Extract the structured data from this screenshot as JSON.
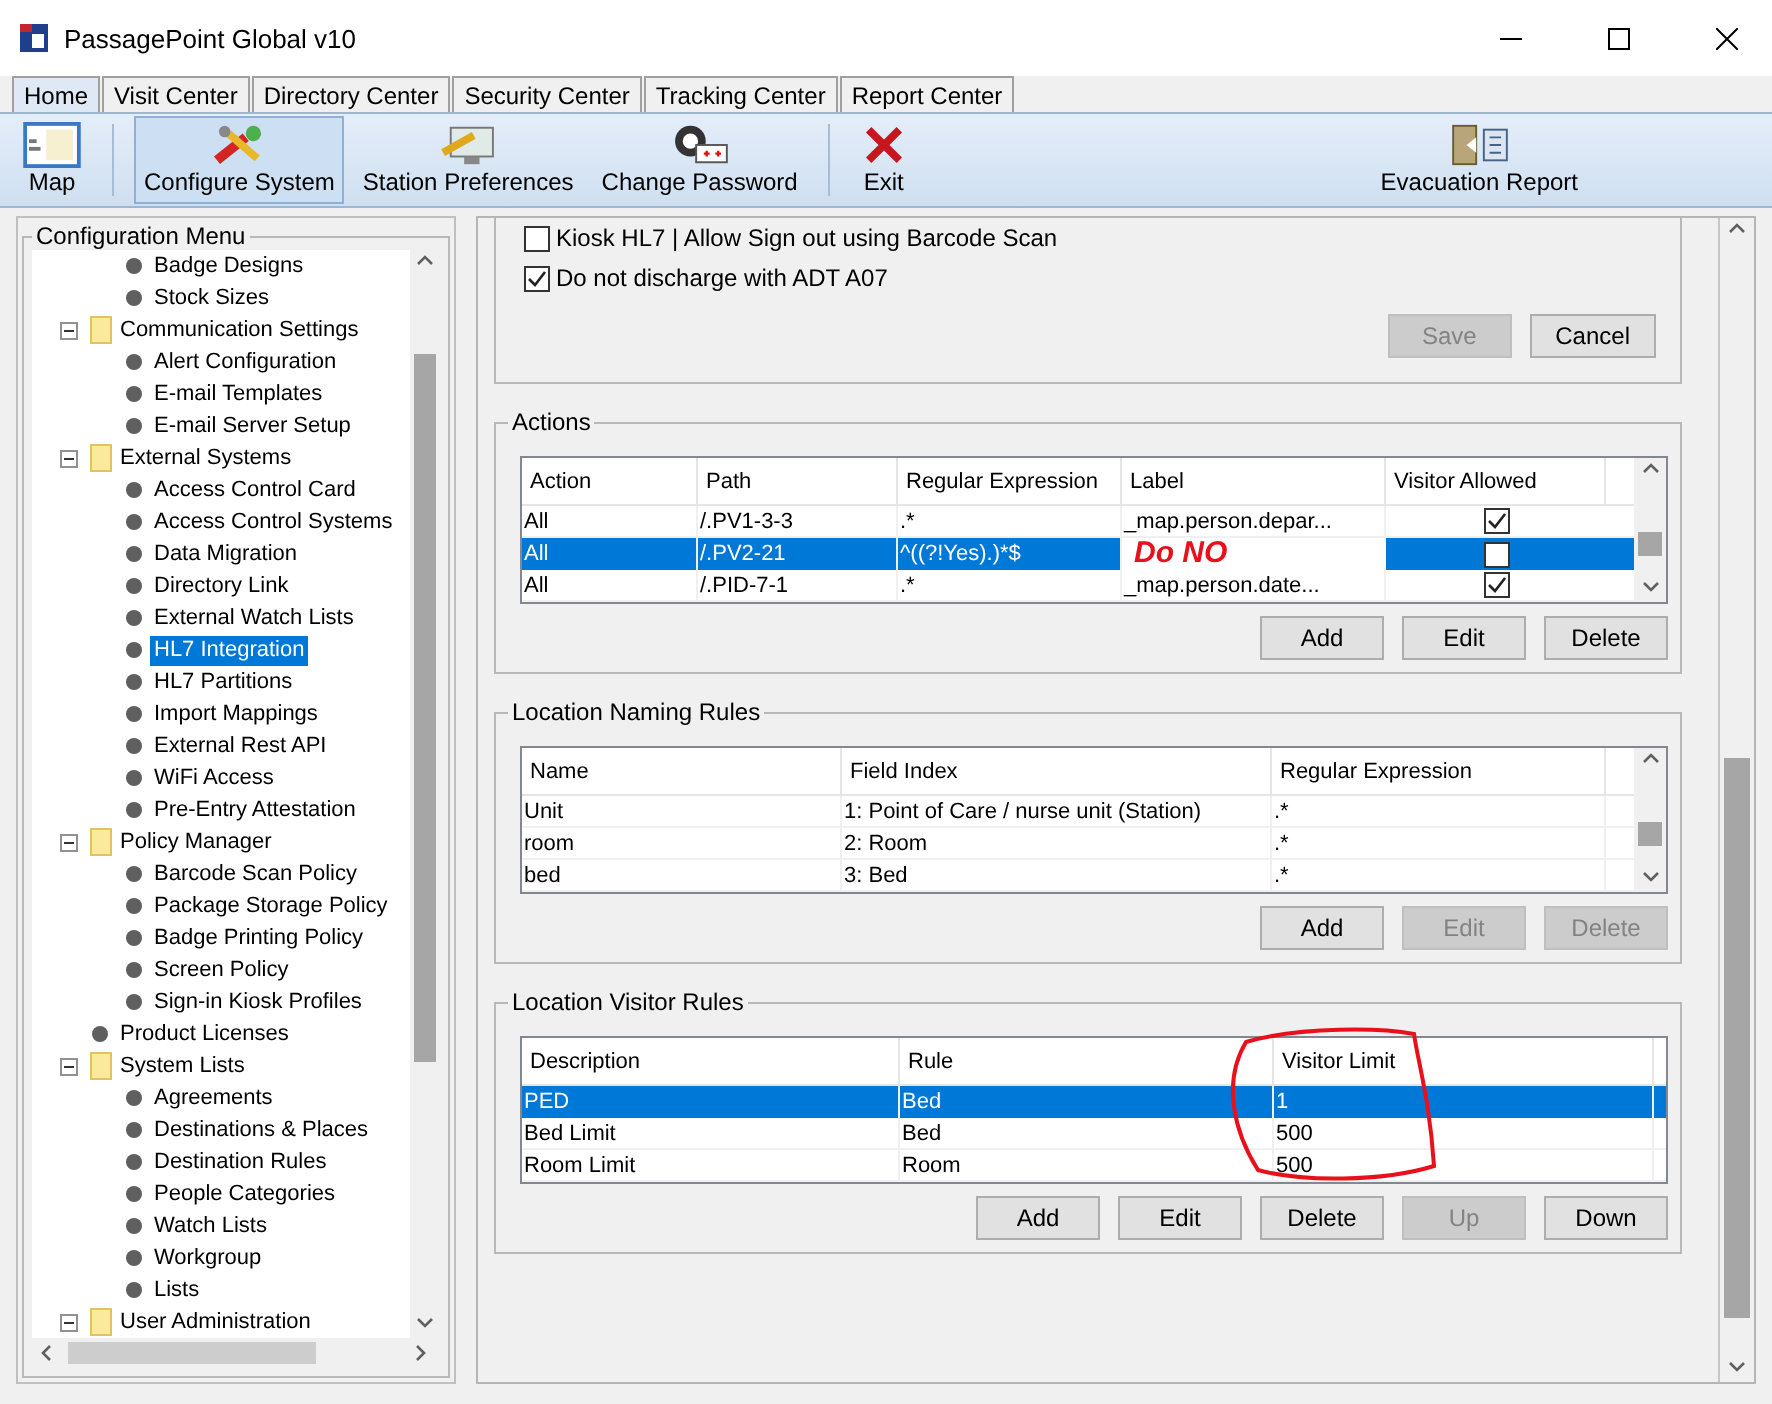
{
  "window": {
    "title": "PassagePoint Global v10"
  },
  "tabs": [
    {
      "label": "Home",
      "selected": true
    },
    {
      "label": "Visit Center",
      "selected": false
    },
    {
      "label": "Directory Center",
      "selected": false
    },
    {
      "label": "Security Center",
      "selected": false
    },
    {
      "label": "Tracking Center",
      "selected": false
    },
    {
      "label": "Report Center",
      "selected": false
    }
  ],
  "toolbar": [
    {
      "label": "Map",
      "kind": "map",
      "selected": false
    },
    {
      "label": "Configure System",
      "kind": "configure",
      "selected": true
    },
    {
      "label": "Station Preferences",
      "kind": "station",
      "selected": false
    },
    {
      "label": "Change Password",
      "kind": "password",
      "selected": false
    },
    {
      "label": "Exit",
      "kind": "exit",
      "selected": false
    },
    {
      "label": "Evacuation Report",
      "kind": "evacuation",
      "selected": false
    }
  ],
  "config_menu": {
    "title": "Configuration Menu",
    "items": [
      {
        "children": [
          {
            "label": "Badge Designs",
            "selected": false
          },
          {
            "label": "Stock Sizes",
            "selected": false
          }
        ]
      },
      {
        "label": "Communication Settings",
        "kind": "folder",
        "expanded": true,
        "selected": false,
        "children": [
          {
            "label": "Alert Configuration",
            "selected": false
          },
          {
            "label": "E-mail Templates",
            "selected": false
          },
          {
            "label": "E-mail Server Setup",
            "selected": false
          }
        ]
      },
      {
        "label": "External Systems",
        "kind": "folder",
        "expanded": true,
        "selected": false,
        "children": [
          {
            "label": "Access Control Card",
            "selected": false
          },
          {
            "label": "Access Control Systems",
            "selected": false
          },
          {
            "label": "Data Migration",
            "selected": false
          },
          {
            "label": "Directory Link",
            "selected": false
          },
          {
            "label": "External Watch Lists",
            "selected": false
          },
          {
            "label": "HL7 Integration",
            "selected": true
          },
          {
            "label": "HL7 Partitions",
            "selected": false
          },
          {
            "label": "Import Mappings",
            "selected": false
          },
          {
            "label": "External Rest API",
            "selected": false
          },
          {
            "label": "WiFi Access",
            "selected": false
          },
          {
            "label": "Pre-Entry Attestation",
            "selected": false
          }
        ]
      },
      {
        "label": "Policy Manager",
        "kind": "folder",
        "expanded": true,
        "selected": false,
        "children": [
          {
            "label": "Barcode Scan Policy",
            "selected": false
          },
          {
            "label": "Package Storage Policy",
            "selected": false
          },
          {
            "label": "Badge Printing Policy",
            "selected": false
          },
          {
            "label": "Screen Policy",
            "selected": false
          },
          {
            "label": "Sign-in Kiosk Profiles",
            "selected": false
          }
        ]
      },
      {
        "label": "Product Licenses",
        "kind": "leaf",
        "selected": false
      },
      {
        "label": "System Lists",
        "kind": "folder",
        "expanded": true,
        "selected": false,
        "children": [
          {
            "label": "Agreements",
            "selected": false
          },
          {
            "label": "Destinations & Places",
            "selected": false
          },
          {
            "label": "Destination Rules",
            "selected": false
          },
          {
            "label": "People Categories",
            "selected": false
          },
          {
            "label": "Watch Lists",
            "selected": false
          },
          {
            "label": "Workgroup",
            "selected": false
          },
          {
            "label": "Lists",
            "selected": false
          }
        ]
      },
      {
        "label": "User Administration",
        "kind": "folder",
        "expanded": true,
        "selected": false
      }
    ]
  },
  "hl7_settings": {
    "checkboxes": [
      {
        "label": "Kiosk HL7 | Allow Sign out using Barcode Scan",
        "checked": false
      },
      {
        "label": "Do not discharge with ADT A07",
        "checked": true
      }
    ],
    "buttons": [
      {
        "label": "Save",
        "disabled": true
      },
      {
        "label": "Cancel",
        "disabled": false
      }
    ]
  },
  "actions": {
    "title": "Actions",
    "columns": [
      "Action",
      "Path",
      "Regular Expression",
      "Label",
      "Visitor Allowed"
    ],
    "rows": [
      {
        "cells": [
          "All",
          "/.PV1-3-3",
          ".*",
          "_map.person.depar..."
        ],
        "label_stamp": false,
        "visitor_allowed": true,
        "selected": false
      },
      {
        "cells": [
          "All",
          "/.PV2-21",
          "^((?!Yes).)*$",
          "Do NO"
        ],
        "label_stamp": true,
        "visitor_allowed": false,
        "selected": true
      },
      {
        "cells": [
          "All",
          "/.PID-7-1",
          ".*",
          "_map.person.date..."
        ],
        "label_stamp": false,
        "visitor_allowed": true,
        "selected": false
      }
    ],
    "buttons": [
      {
        "label": "Add",
        "disabled": false
      },
      {
        "label": "Edit",
        "disabled": false
      },
      {
        "label": "Delete",
        "disabled": false
      }
    ]
  },
  "location_naming_rules": {
    "title": "Location Naming Rules",
    "columns": [
      "Name",
      "Field Index",
      "Regular Expression"
    ],
    "rows": [
      {
        "cells": [
          "Unit",
          "1: Point of Care / nurse unit (Station)",
          ".*"
        ],
        "selected": false
      },
      {
        "cells": [
          "room",
          "2: Room",
          ".*"
        ],
        "selected": false
      },
      {
        "cells": [
          "bed",
          "3: Bed",
          ".*"
        ],
        "selected": false
      }
    ],
    "buttons": [
      {
        "label": "Add",
        "disabled": false
      },
      {
        "label": "Edit",
        "disabled": true
      },
      {
        "label": "Delete",
        "disabled": true
      }
    ]
  },
  "location_visitor_rules": {
    "title": "Location Visitor Rules",
    "columns": [
      "Description",
      "Rule",
      "Visitor Limit"
    ],
    "rows": [
      {
        "cells": [
          "PED",
          "Bed",
          "1"
        ],
        "selected": true
      },
      {
        "cells": [
          "Bed Limit",
          "Bed",
          "500"
        ],
        "selected": false
      },
      {
        "cells": [
          "Room Limit",
          "Room",
          "500"
        ],
        "selected": false
      }
    ],
    "buttons": [
      {
        "label": "Add",
        "disabled": false
      },
      {
        "label": "Edit",
        "disabled": false
      },
      {
        "label": "Delete",
        "disabled": false
      },
      {
        "label": "Up",
        "disabled": true
      },
      {
        "label": "Down",
        "disabled": false
      }
    ]
  }
}
